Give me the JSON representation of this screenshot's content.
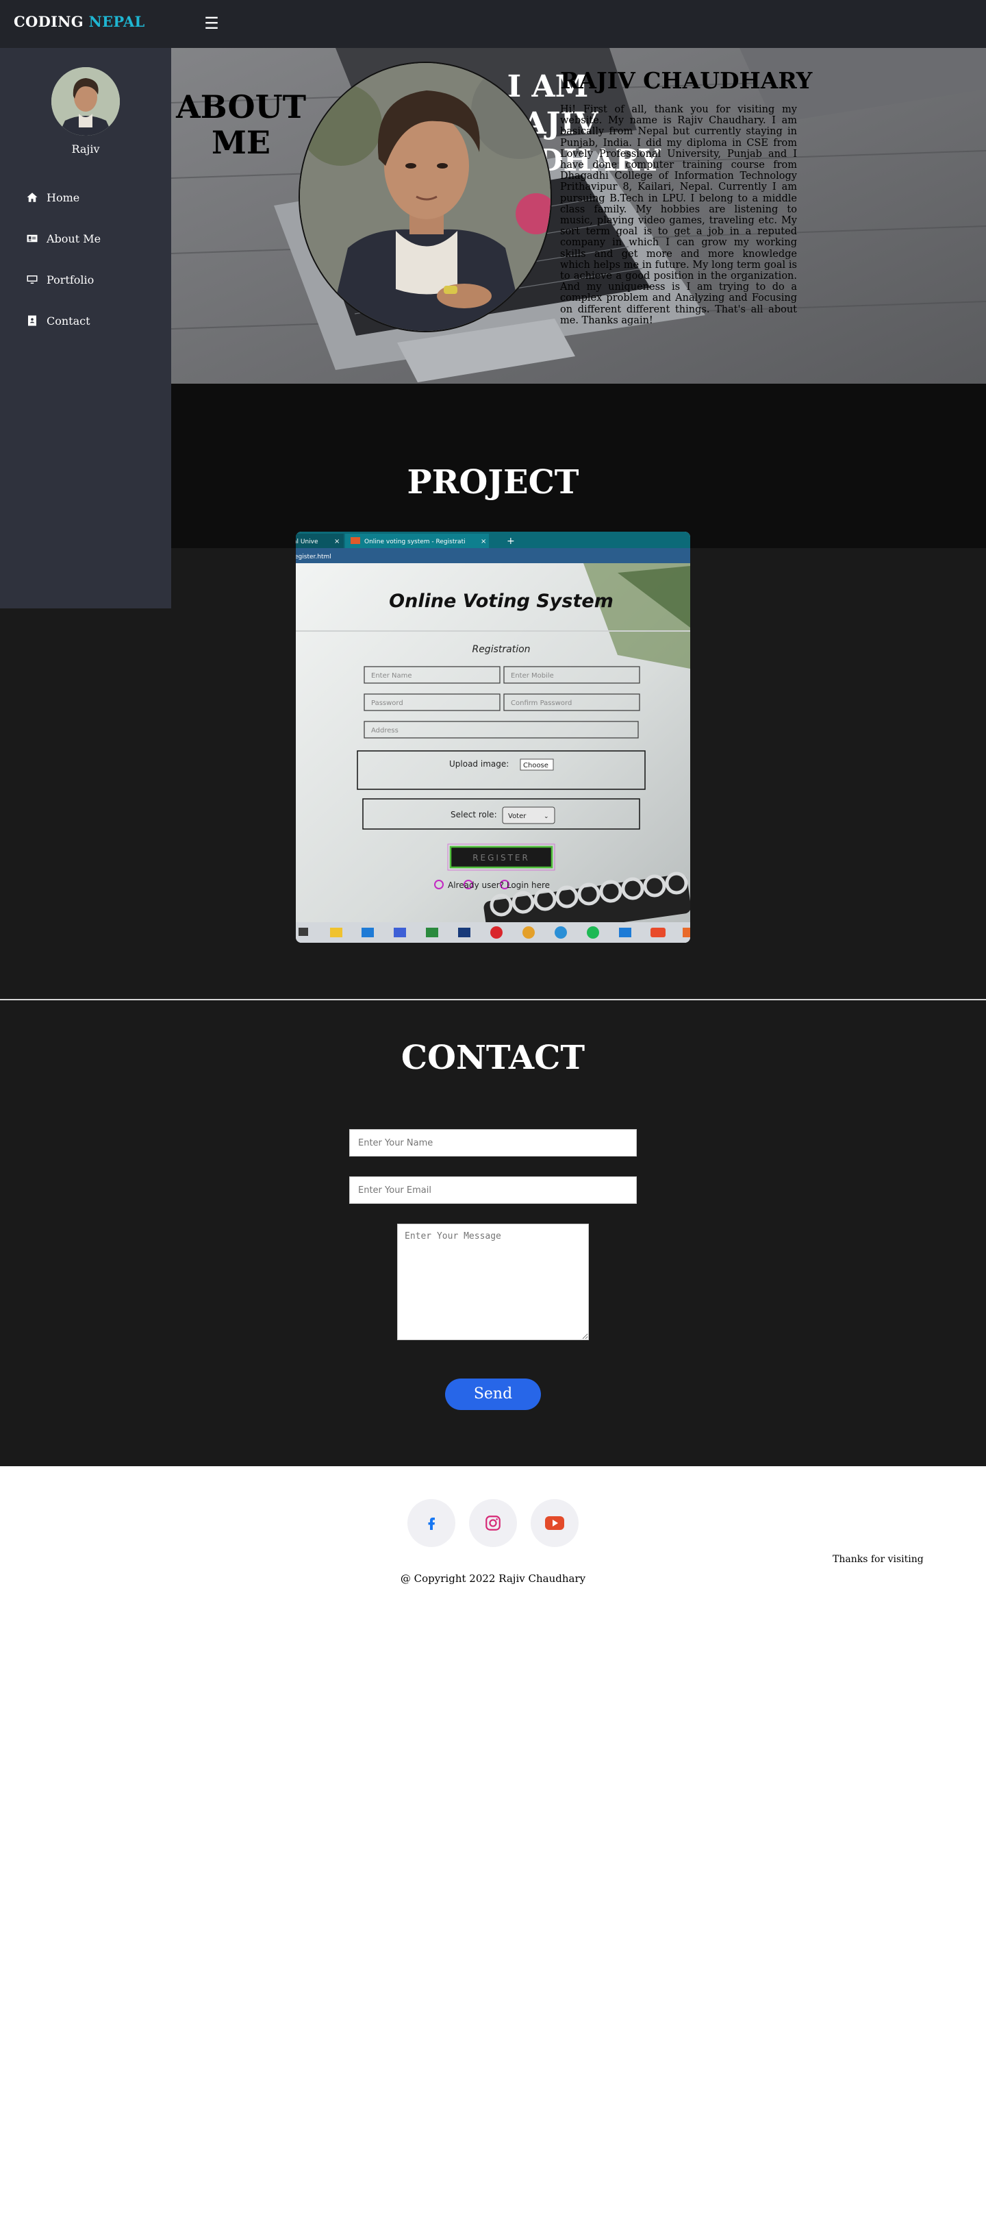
{
  "header": {
    "logo_main": "CODING ",
    "logo_accent": "NEPAL",
    "menu_icon": "hamburger-icon"
  },
  "sidebar": {
    "profile_name": "Rajiv",
    "items": [
      {
        "label": "Home",
        "icon": "home-icon"
      },
      {
        "label": "About Me",
        "icon": "id-card-icon"
      },
      {
        "label": "Portfolio",
        "icon": "desktop-icon"
      },
      {
        "label": "Contact",
        "icon": "contact-book-icon"
      }
    ]
  },
  "about": {
    "title_line1": "ABOUT",
    "title_line2": "ME",
    "bg_name_line1": "I AM",
    "bg_name_line2": "RAJIV CHAUDHARY",
    "name": "RAJIV CHAUDHARY",
    "bio": "Hi! First of all, thank you for visiting my website. My name is Rajiv Chaudhary. I am basically from Nepal but currently staying in Punjab, India. I did my diploma in CSE from Lovely Professional University, Punjab and I have done computer training course from Dhagadhi College of Information Technology Prithavipur 8, Kailari, Nepal. Currently I am pursuing B.Tech in LPU. I belong to a middle class family. My hobbies are listening to music, playing video games, traveling etc. My sort term goal is to get a job in a reputed company in which I can grow my working skills and get more and more knowledge which helps me in future. My long term goal is to achieve a good position in the organization. And my uniqueness is I am trying to do a complex problem and Analyzing and Focusing on different different things. That's all about me. Thanks again!"
  },
  "project": {
    "title": "PROJECT",
    "screenshot": {
      "tab_left": "al Unive",
      "tab_active": "Online voting system - Registrati",
      "address": "egister.html",
      "heading": "Online Voting System",
      "subheading": "Registration",
      "placeholders": {
        "name": "Enter Name",
        "mobile": "Enter Mobile",
        "password": "Password",
        "confirm": "Confirm Password",
        "address": "Address"
      },
      "upload_label": "Upload image:",
      "upload_button": "Choose",
      "role_label": "Select role:",
      "role_value": "Voter",
      "register_button": "REGISTER",
      "login_text": "Already user? Login here"
    }
  },
  "contact": {
    "title": "CONTACT",
    "name_placeholder": "Enter Your Name",
    "email_placeholder": "Enter Your Email",
    "message_placeholder": "Enter Your Message",
    "send_label": "Send"
  },
  "footer": {
    "social": [
      {
        "icon": "facebook-icon",
        "color": "#1877f2"
      },
      {
        "icon": "instagram-icon",
        "color": "#d62976"
      },
      {
        "icon": "youtube-icon",
        "color": "#e34b2a"
      }
    ],
    "thanks": "Thanks for visiting",
    "copyright": "@ Copyright 2022 Rajiv Chaudhary"
  }
}
